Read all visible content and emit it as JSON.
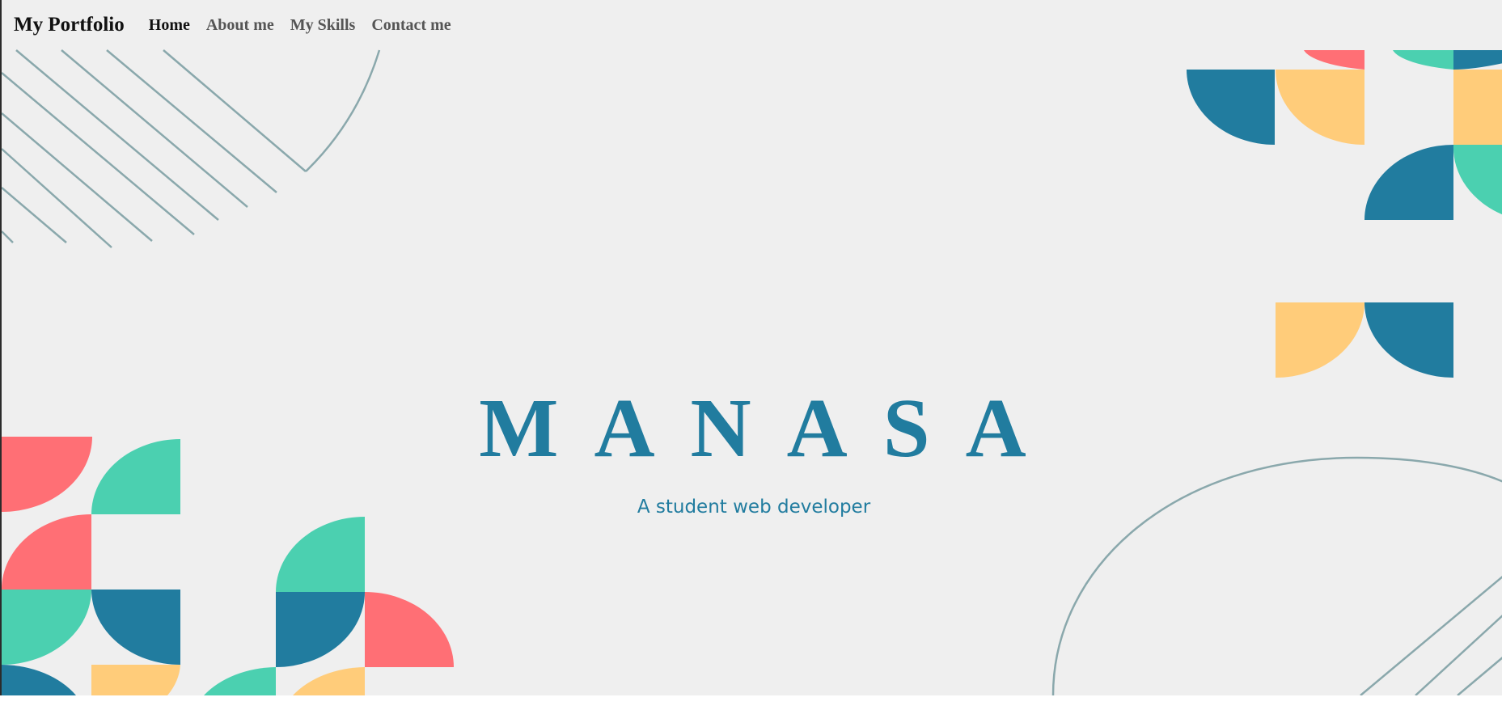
{
  "navbar": {
    "brand": "My Portfolio",
    "links": [
      {
        "label": "Home",
        "active": true
      },
      {
        "label": "About me",
        "active": false
      },
      {
        "label": "My Skills",
        "active": false
      },
      {
        "label": "Contact me",
        "active": false
      }
    ]
  },
  "hero": {
    "title": "MANASA",
    "subtitle": "A student web developer"
  },
  "colors": {
    "background": "#efefef",
    "accent_blue": "#217c9f",
    "teal": "#4bd0b0",
    "coral": "#ff6f75",
    "yellow": "#ffcc7a",
    "line_gray": "#8aa8ac"
  }
}
